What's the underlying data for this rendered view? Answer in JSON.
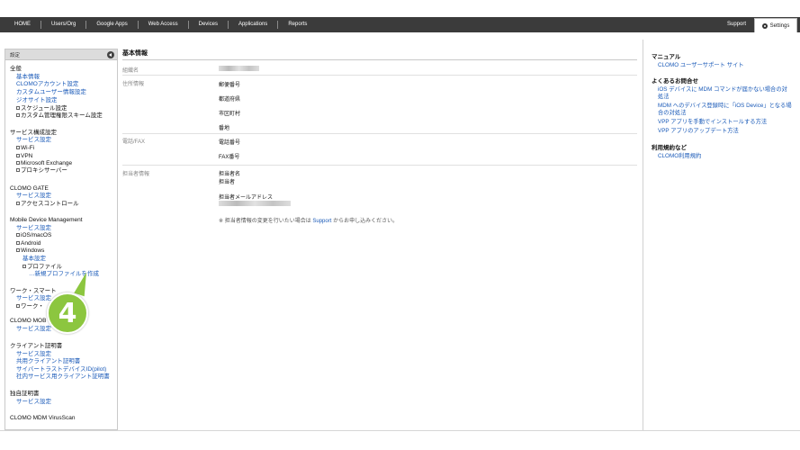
{
  "nav": {
    "items": [
      "HOME",
      "Users/Org",
      "Google Apps",
      "Web Access",
      "Devices",
      "Applications",
      "Reports"
    ],
    "support": "Support",
    "settings": "Settings"
  },
  "sidebar": {
    "header": "設定",
    "lines": [
      {
        "text": "全般",
        "kind": "sec"
      },
      {
        "text": "基本情報",
        "kind": "link"
      },
      {
        "text": "CLOMOアカウント設定",
        "kind": "link"
      },
      {
        "text": "カスタムユーザー情報設定",
        "kind": "link"
      },
      {
        "text": "ジオサイト設定",
        "kind": "link"
      },
      {
        "text": "スケジュール設定",
        "kind": "tree"
      },
      {
        "text": "カスタム管理権限スキーム設定",
        "kind": "tree"
      },
      {
        "text": "サービス構成設定",
        "kind": "sec"
      },
      {
        "text": "サービス設定",
        "kind": "link"
      },
      {
        "text": "Wi-Fi",
        "kind": "tree"
      },
      {
        "text": "VPN",
        "kind": "tree"
      },
      {
        "text": "Microsoft Exchange",
        "kind": "tree"
      },
      {
        "text": "プロキシサーバー",
        "kind": "tree"
      },
      {
        "text": "CLOMO GATE",
        "kind": "sec"
      },
      {
        "text": "サービス設定",
        "kind": "link"
      },
      {
        "text": "アクセスコントロール",
        "kind": "tree"
      },
      {
        "text": "Mobile Device Management",
        "kind": "sec"
      },
      {
        "text": "サービス設定",
        "kind": "link"
      },
      {
        "text": "iOS/macOS",
        "kind": "tree"
      },
      {
        "text": "Android",
        "kind": "tree"
      },
      {
        "text": "Windows",
        "kind": "tree"
      },
      {
        "text": "基本設定",
        "kind": "link"
      },
      {
        "text": "プロファイル",
        "kind": "tree"
      },
      {
        "text": "…新規プロファイルを作成",
        "kind": "link"
      },
      {
        "text": "ワーク・スマート",
        "kind": "sec"
      },
      {
        "text": "サービス設定",
        "kind": "link"
      },
      {
        "text": "ワーク・",
        "kind": "tree"
      },
      {
        "text": "CLOMO MOB",
        "kind": "sec"
      },
      {
        "text": "サービス設定",
        "kind": "link"
      },
      {
        "text": "クライアント証明書",
        "kind": "sec"
      },
      {
        "text": "サービス設定",
        "kind": "link"
      },
      {
        "text": "共用クライアント証明書",
        "kind": "link"
      },
      {
        "text": "サイバートラストデバイスID(pilot)",
        "kind": "link"
      },
      {
        "text": "社内サービス用クライアント証明書",
        "kind": "link"
      },
      {
        "text": "独自証明書",
        "kind": "sec"
      },
      {
        "text": "サービス設定",
        "kind": "link"
      },
      {
        "text": "CLOMO MDM VirusScan",
        "kind": "sec"
      }
    ]
  },
  "main": {
    "title": "基本情報",
    "org_label": "組織名",
    "address_label": "住所情報",
    "postal": "郵便番号",
    "prefecture": "都道府県",
    "city": "市区町村",
    "street": "番地",
    "phone_label": "電話/FAX",
    "phone": "電話番号",
    "fax": "FAX番号",
    "contact_label": "担当者情報",
    "contact_name_label": "担当者名",
    "contact_name_value": "担当者",
    "contact_email_label": "担当者メールアドレス",
    "note_prefix": "※ 担当者情報の変更を行いたい場合は",
    "note_link": "Support",
    "note_suffix": "からお申し込みください。"
  },
  "right": {
    "manual_heading": "マニュアル",
    "manual_link": "CLOMO ユーザーサポート サイト",
    "faq_heading": "よくあるお問合せ",
    "faq_links": [
      "iOS デバイスに MDM コマンドが届かない場合の対処法",
      "MDM へのデバイス登録時に「iOS Device」となる場合の対処法",
      "VPP アプリを手動でインストールする方法",
      "VPP アプリのアップデート方法"
    ],
    "terms_heading": "利用規約など",
    "terms_link": "CLOMO利用規約"
  },
  "callout": {
    "number": "4"
  },
  "colors": {
    "nav": "#3b3b3b",
    "link": "#1a5ab8",
    "callout": "#8cc63f"
  }
}
